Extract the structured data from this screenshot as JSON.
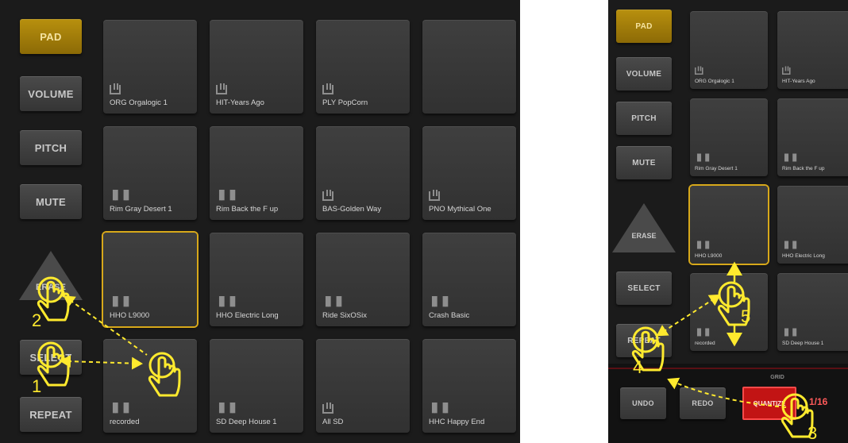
{
  "left": {
    "side_buttons": {
      "pad": "PAD",
      "volume": "VOLUME",
      "pitch": "PITCH",
      "mute": "MUTE",
      "erase": "ERASE",
      "select": "SELECT",
      "repeat": "REPEAT"
    },
    "pads": [
      {
        "label": "ORG Orgalogic 1",
        "icon": "piano-icon"
      },
      {
        "label": "HIT-Years Ago",
        "icon": "piano-icon"
      },
      {
        "label": "PLY PopCorn",
        "icon": "piano-icon"
      },
      {
        "label": "",
        "icon": ""
      },
      {
        "label": "Rim Gray Desert 1",
        "icon": "waveform-icon"
      },
      {
        "label": "Rim Back the F up",
        "icon": "waveform-icon"
      },
      {
        "label": "BAS-Golden Way",
        "icon": "piano-icon"
      },
      {
        "label": "PNO Mythical One",
        "icon": "piano-icon"
      },
      {
        "label": "HHO L9000",
        "icon": "waveform-icon",
        "selected": true
      },
      {
        "label": "HHO Electric Long",
        "icon": "waveform-icon"
      },
      {
        "label": "Ride SixOSix",
        "icon": "waveform-icon"
      },
      {
        "label": "Crash Basic",
        "icon": "waveform-icon"
      },
      {
        "label": "recorded",
        "icon": "waveform-icon"
      },
      {
        "label": "SD Deep House 1",
        "icon": "waveform-icon"
      },
      {
        "label": "All SD",
        "icon": "piano-icon"
      },
      {
        "label": "HHC Happy End",
        "icon": "waveform-icon"
      }
    ],
    "gesture_numbers": {
      "one": "1",
      "two": "2"
    }
  },
  "right": {
    "side_buttons": {
      "pad": "PAD",
      "volume": "VOLUME",
      "pitch": "PITCH",
      "mute": "MUTE",
      "erase": "ERASE",
      "select": "SELECT",
      "repeat": "REPEAT"
    },
    "pads": [
      {
        "label": "ORG Orgalogic 1",
        "icon": "piano-icon"
      },
      {
        "label": "HIT-Years Ago",
        "icon": "piano-icon"
      },
      {
        "label": "Rim Gray Desert 1",
        "icon": "waveform-icon"
      },
      {
        "label": "Rim Back the F up",
        "icon": "waveform-icon"
      },
      {
        "label": "HHO L9000",
        "icon": "waveform-icon",
        "selected": true
      },
      {
        "label": "HHO Electric Long",
        "icon": "waveform-icon"
      },
      {
        "label": "recorded",
        "icon": "waveform-icon"
      },
      {
        "label": "SD Deep House 1",
        "icon": "waveform-icon"
      }
    ],
    "bottom": {
      "undo": "UNDO",
      "redo": "REDO",
      "grid": "GRID",
      "quantize": "QUANTIZE",
      "fraction": "1/16"
    },
    "gesture_numbers": {
      "three": "3",
      "four": "4",
      "five": "5"
    }
  },
  "colors": {
    "active": "#b8900e",
    "selected_outline": "#d7a81a",
    "annotation": "#ffea2e",
    "quantize": "#c21414"
  }
}
